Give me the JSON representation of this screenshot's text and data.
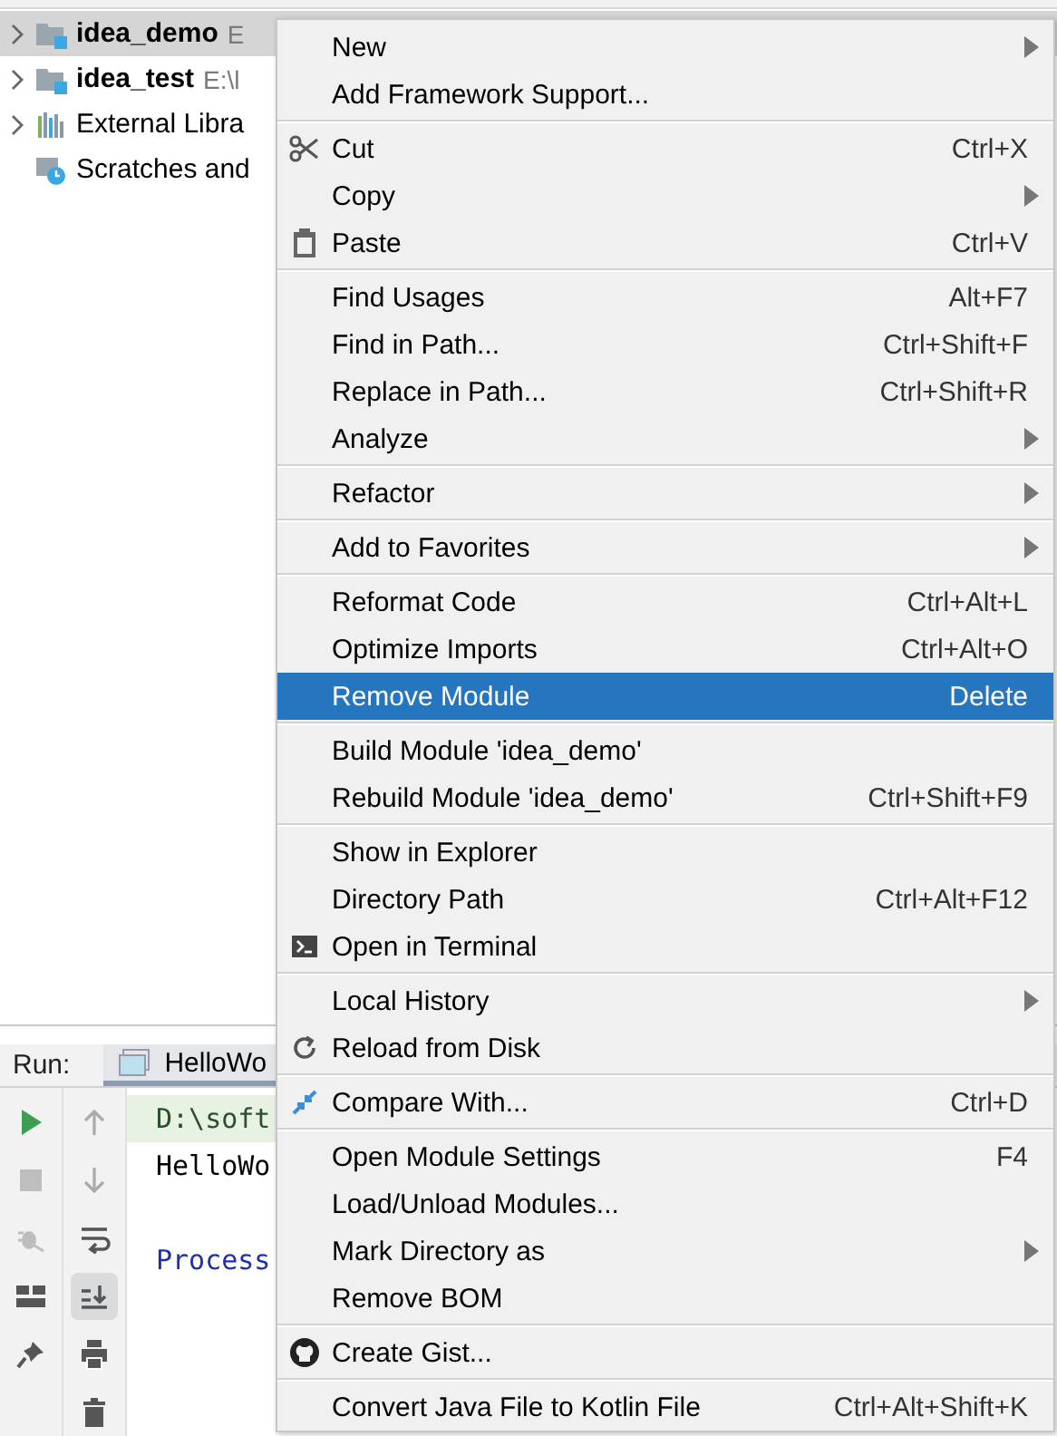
{
  "project_tree": {
    "items": [
      {
        "name": "idea_demo",
        "path": "E",
        "kind": "module",
        "bold": true,
        "selected": true
      },
      {
        "name": "idea_test",
        "path": "E:\\l",
        "kind": "module",
        "bold": true,
        "selected": false
      },
      {
        "name": "External Libra",
        "kind": "libraries",
        "bold": false,
        "selected": false
      },
      {
        "name": "Scratches and",
        "kind": "scratches",
        "bold": false,
        "selected": false
      }
    ]
  },
  "run_panel": {
    "label": "Run:",
    "tab": "HelloWo",
    "toolbar_left": [
      {
        "kind": "play",
        "disabled": false
      },
      {
        "kind": "stop",
        "disabled": true
      },
      {
        "kind": "bug",
        "disabled": true
      },
      {
        "kind": "layout",
        "disabled": false
      },
      {
        "kind": "pin",
        "disabled": false
      }
    ],
    "toolbar_right": [
      {
        "kind": "up",
        "selected": false
      },
      {
        "kind": "down",
        "selected": false
      },
      {
        "kind": "wrap",
        "selected": false
      },
      {
        "kind": "scroll-end",
        "selected": true
      },
      {
        "kind": "print",
        "selected": false
      },
      {
        "kind": "trash",
        "selected": false
      }
    ],
    "console": [
      {
        "text": "D:\\soft",
        "kind": "command"
      },
      {
        "text": "HelloWo",
        "kind": "output"
      },
      {
        "kind": "blank"
      },
      {
        "text": "Process",
        "kind": "system"
      }
    ]
  },
  "context_menu": {
    "groups": [
      [
        {
          "label": "New",
          "kind": "plain",
          "submenu": true,
          "selected": false
        },
        {
          "label": "Add Framework Support...",
          "kind": "plain",
          "submenu": false,
          "selected": false
        }
      ],
      [
        {
          "label": "Cut",
          "kind": "scissors",
          "shortcut": "Ctrl+X",
          "submenu": false,
          "selected": false
        },
        {
          "label": "Copy",
          "kind": "plain",
          "submenu": true,
          "selected": false
        },
        {
          "label": "Paste",
          "kind": "clipboard",
          "shortcut": "Ctrl+V",
          "submenu": false,
          "selected": false
        }
      ],
      [
        {
          "label": "Find Usages",
          "kind": "plain",
          "shortcut": "Alt+F7",
          "submenu": false,
          "selected": false
        },
        {
          "label": "Find in Path...",
          "kind": "plain",
          "shortcut": "Ctrl+Shift+F",
          "submenu": false,
          "selected": false
        },
        {
          "label": "Replace in Path...",
          "kind": "plain",
          "shortcut": "Ctrl+Shift+R",
          "submenu": false,
          "selected": false
        },
        {
          "label": "Analyze",
          "kind": "plain",
          "submenu": true,
          "selected": false
        }
      ],
      [
        {
          "label": "Refactor",
          "kind": "plain",
          "submenu": true,
          "selected": false
        }
      ],
      [
        {
          "label": "Add to Favorites",
          "kind": "plain",
          "submenu": true,
          "selected": false
        }
      ],
      [
        {
          "label": "Reformat Code",
          "kind": "plain",
          "shortcut": "Ctrl+Alt+L",
          "submenu": false,
          "selected": false
        },
        {
          "label": "Optimize Imports",
          "kind": "plain",
          "shortcut": "Ctrl+Alt+O",
          "submenu": false,
          "selected": false
        },
        {
          "label": "Remove Module",
          "kind": "plain",
          "shortcut": "Delete",
          "submenu": false,
          "selected": true
        }
      ],
      [
        {
          "label": "Build Module 'idea_demo'",
          "kind": "plain",
          "submenu": false,
          "selected": false
        },
        {
          "label": "Rebuild Module 'idea_demo'",
          "kind": "plain",
          "shortcut": "Ctrl+Shift+F9",
          "submenu": false,
          "selected": false
        }
      ],
      [
        {
          "label": "Show in Explorer",
          "kind": "plain",
          "submenu": false,
          "selected": false
        },
        {
          "label": "Directory Path",
          "kind": "plain",
          "shortcut": "Ctrl+Alt+F12",
          "submenu": false,
          "selected": false
        },
        {
          "label": "Open in Terminal",
          "kind": "terminal",
          "submenu": false,
          "selected": false
        }
      ],
      [
        {
          "label": "Local History",
          "kind": "plain",
          "submenu": true,
          "selected": false
        },
        {
          "label": "Reload from Disk",
          "kind": "reload",
          "submenu": false,
          "selected": false
        }
      ],
      [
        {
          "label": "Compare With...",
          "kind": "compare",
          "shortcut": "Ctrl+D",
          "submenu": false,
          "selected": false
        }
      ],
      [
        {
          "label": "Open Module Settings",
          "kind": "plain",
          "shortcut": "F4",
          "submenu": false,
          "selected": false
        },
        {
          "label": "Load/Unload Modules...",
          "kind": "plain",
          "submenu": false,
          "selected": false
        },
        {
          "label": "Mark Directory as",
          "kind": "plain",
          "submenu": true,
          "selected": false
        },
        {
          "label": "Remove BOM",
          "kind": "plain",
          "submenu": false,
          "selected": false
        }
      ],
      [
        {
          "label": "Create Gist...",
          "kind": "github",
          "submenu": false,
          "selected": false
        }
      ],
      [
        {
          "label": "Convert Java File to Kotlin File",
          "kind": "plain",
          "shortcut": "Ctrl+Alt+Shift+K",
          "submenu": false,
          "selected": false
        }
      ]
    ]
  }
}
